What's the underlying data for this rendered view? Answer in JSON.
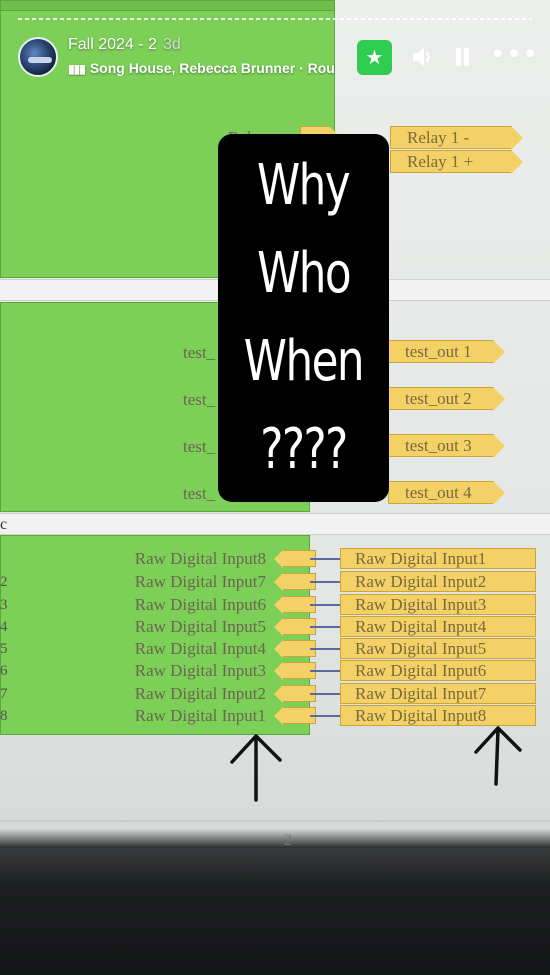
{
  "story": {
    "title": "Fall 2024 - 2",
    "age": "3d",
    "music": "Song House, Rebecca Brunner · Rou",
    "icons": {
      "avatar": "avatar",
      "star": "star-icon",
      "sound": "speaker-icon",
      "pause": "pause-icon",
      "more": "more-icon",
      "music": "music-bars-icon"
    }
  },
  "overlay": {
    "lines": [
      "Why",
      "Who",
      "When",
      "????"
    ]
  },
  "diagram": {
    "relay_left": "Relay",
    "relay_outputs": [
      "Relay 1 -",
      "Relay 1 +"
    ],
    "test_left": [
      "test_",
      "test_",
      "test_",
      "test_"
    ],
    "test_outputs": [
      "test_out 1",
      "test_out 2",
      "test_out 3",
      "test_out 4"
    ],
    "cut_text": "c",
    "inputs_left": [
      "Raw Digital Input8",
      "Raw Digital Input7",
      "Raw Digital Input6",
      "Raw Digital Input5",
      "Raw Digital Input4",
      "Raw Digital Input3",
      "Raw Digital Input2",
      "Raw Digital Input1"
    ],
    "inputs_right": [
      "Raw Digital Input1",
      "Raw Digital Input2",
      "Raw Digital Input3",
      "Raw Digital Input4",
      "Raw Digital Input5",
      "Raw Digital Input6",
      "Raw Digital Input7",
      "Raw Digital Input8"
    ],
    "left_numbers": [
      "2",
      "3",
      "4",
      "5",
      "6",
      "7",
      "8"
    ],
    "page_number": "2"
  },
  "colors": {
    "green_block": "#7ccf57",
    "tag_yellow": "#f3d166",
    "star_button": "#2ecc50"
  }
}
